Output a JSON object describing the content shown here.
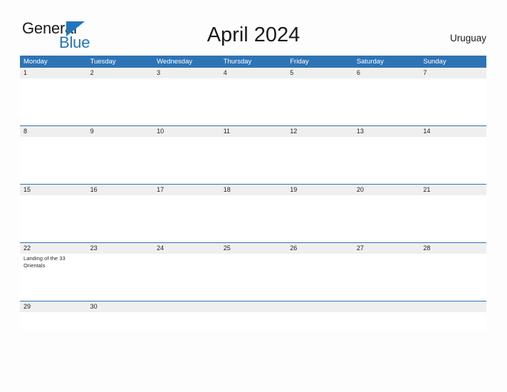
{
  "logo": {
    "word_one": "General",
    "word_two": "Blue",
    "triangle_icon": "triangle-icon",
    "color_primary": "#2176bd",
    "color_text": "#1b1b1b"
  },
  "header": {
    "title": "April 2024",
    "country": "Uruguay"
  },
  "colors": {
    "header_blue": "#2e74b5",
    "date_band_gray": "#efefef",
    "page_background": "#fdfdfd",
    "weekday_text": "#ffffff"
  },
  "calendar": {
    "month": "April",
    "year": "2024",
    "weekday_headers": [
      "Monday",
      "Tuesday",
      "Wednesday",
      "Thursday",
      "Friday",
      "Saturday",
      "Sunday"
    ],
    "weeks": [
      {
        "days": [
          {
            "date": "1",
            "event": ""
          },
          {
            "date": "2",
            "event": ""
          },
          {
            "date": "3",
            "event": ""
          },
          {
            "date": "4",
            "event": ""
          },
          {
            "date": "5",
            "event": ""
          },
          {
            "date": "6",
            "event": ""
          },
          {
            "date": "7",
            "event": ""
          }
        ]
      },
      {
        "days": [
          {
            "date": "8",
            "event": ""
          },
          {
            "date": "9",
            "event": ""
          },
          {
            "date": "10",
            "event": ""
          },
          {
            "date": "11",
            "event": ""
          },
          {
            "date": "12",
            "event": ""
          },
          {
            "date": "13",
            "event": ""
          },
          {
            "date": "14",
            "event": ""
          }
        ]
      },
      {
        "days": [
          {
            "date": "15",
            "event": ""
          },
          {
            "date": "16",
            "event": ""
          },
          {
            "date": "17",
            "event": ""
          },
          {
            "date": "18",
            "event": ""
          },
          {
            "date": "19",
            "event": ""
          },
          {
            "date": "20",
            "event": ""
          },
          {
            "date": "21",
            "event": ""
          }
        ]
      },
      {
        "days": [
          {
            "date": "22",
            "event": "Landing of the 33 Orientals"
          },
          {
            "date": "23",
            "event": ""
          },
          {
            "date": "24",
            "event": ""
          },
          {
            "date": "25",
            "event": ""
          },
          {
            "date": "26",
            "event": ""
          },
          {
            "date": "27",
            "event": ""
          },
          {
            "date": "28",
            "event": ""
          }
        ]
      },
      {
        "days": [
          {
            "date": "29",
            "event": ""
          },
          {
            "date": "30",
            "event": ""
          },
          {
            "date": "",
            "event": ""
          },
          {
            "date": "",
            "event": ""
          },
          {
            "date": "",
            "event": ""
          },
          {
            "date": "",
            "event": ""
          },
          {
            "date": "",
            "event": ""
          }
        ]
      }
    ]
  }
}
